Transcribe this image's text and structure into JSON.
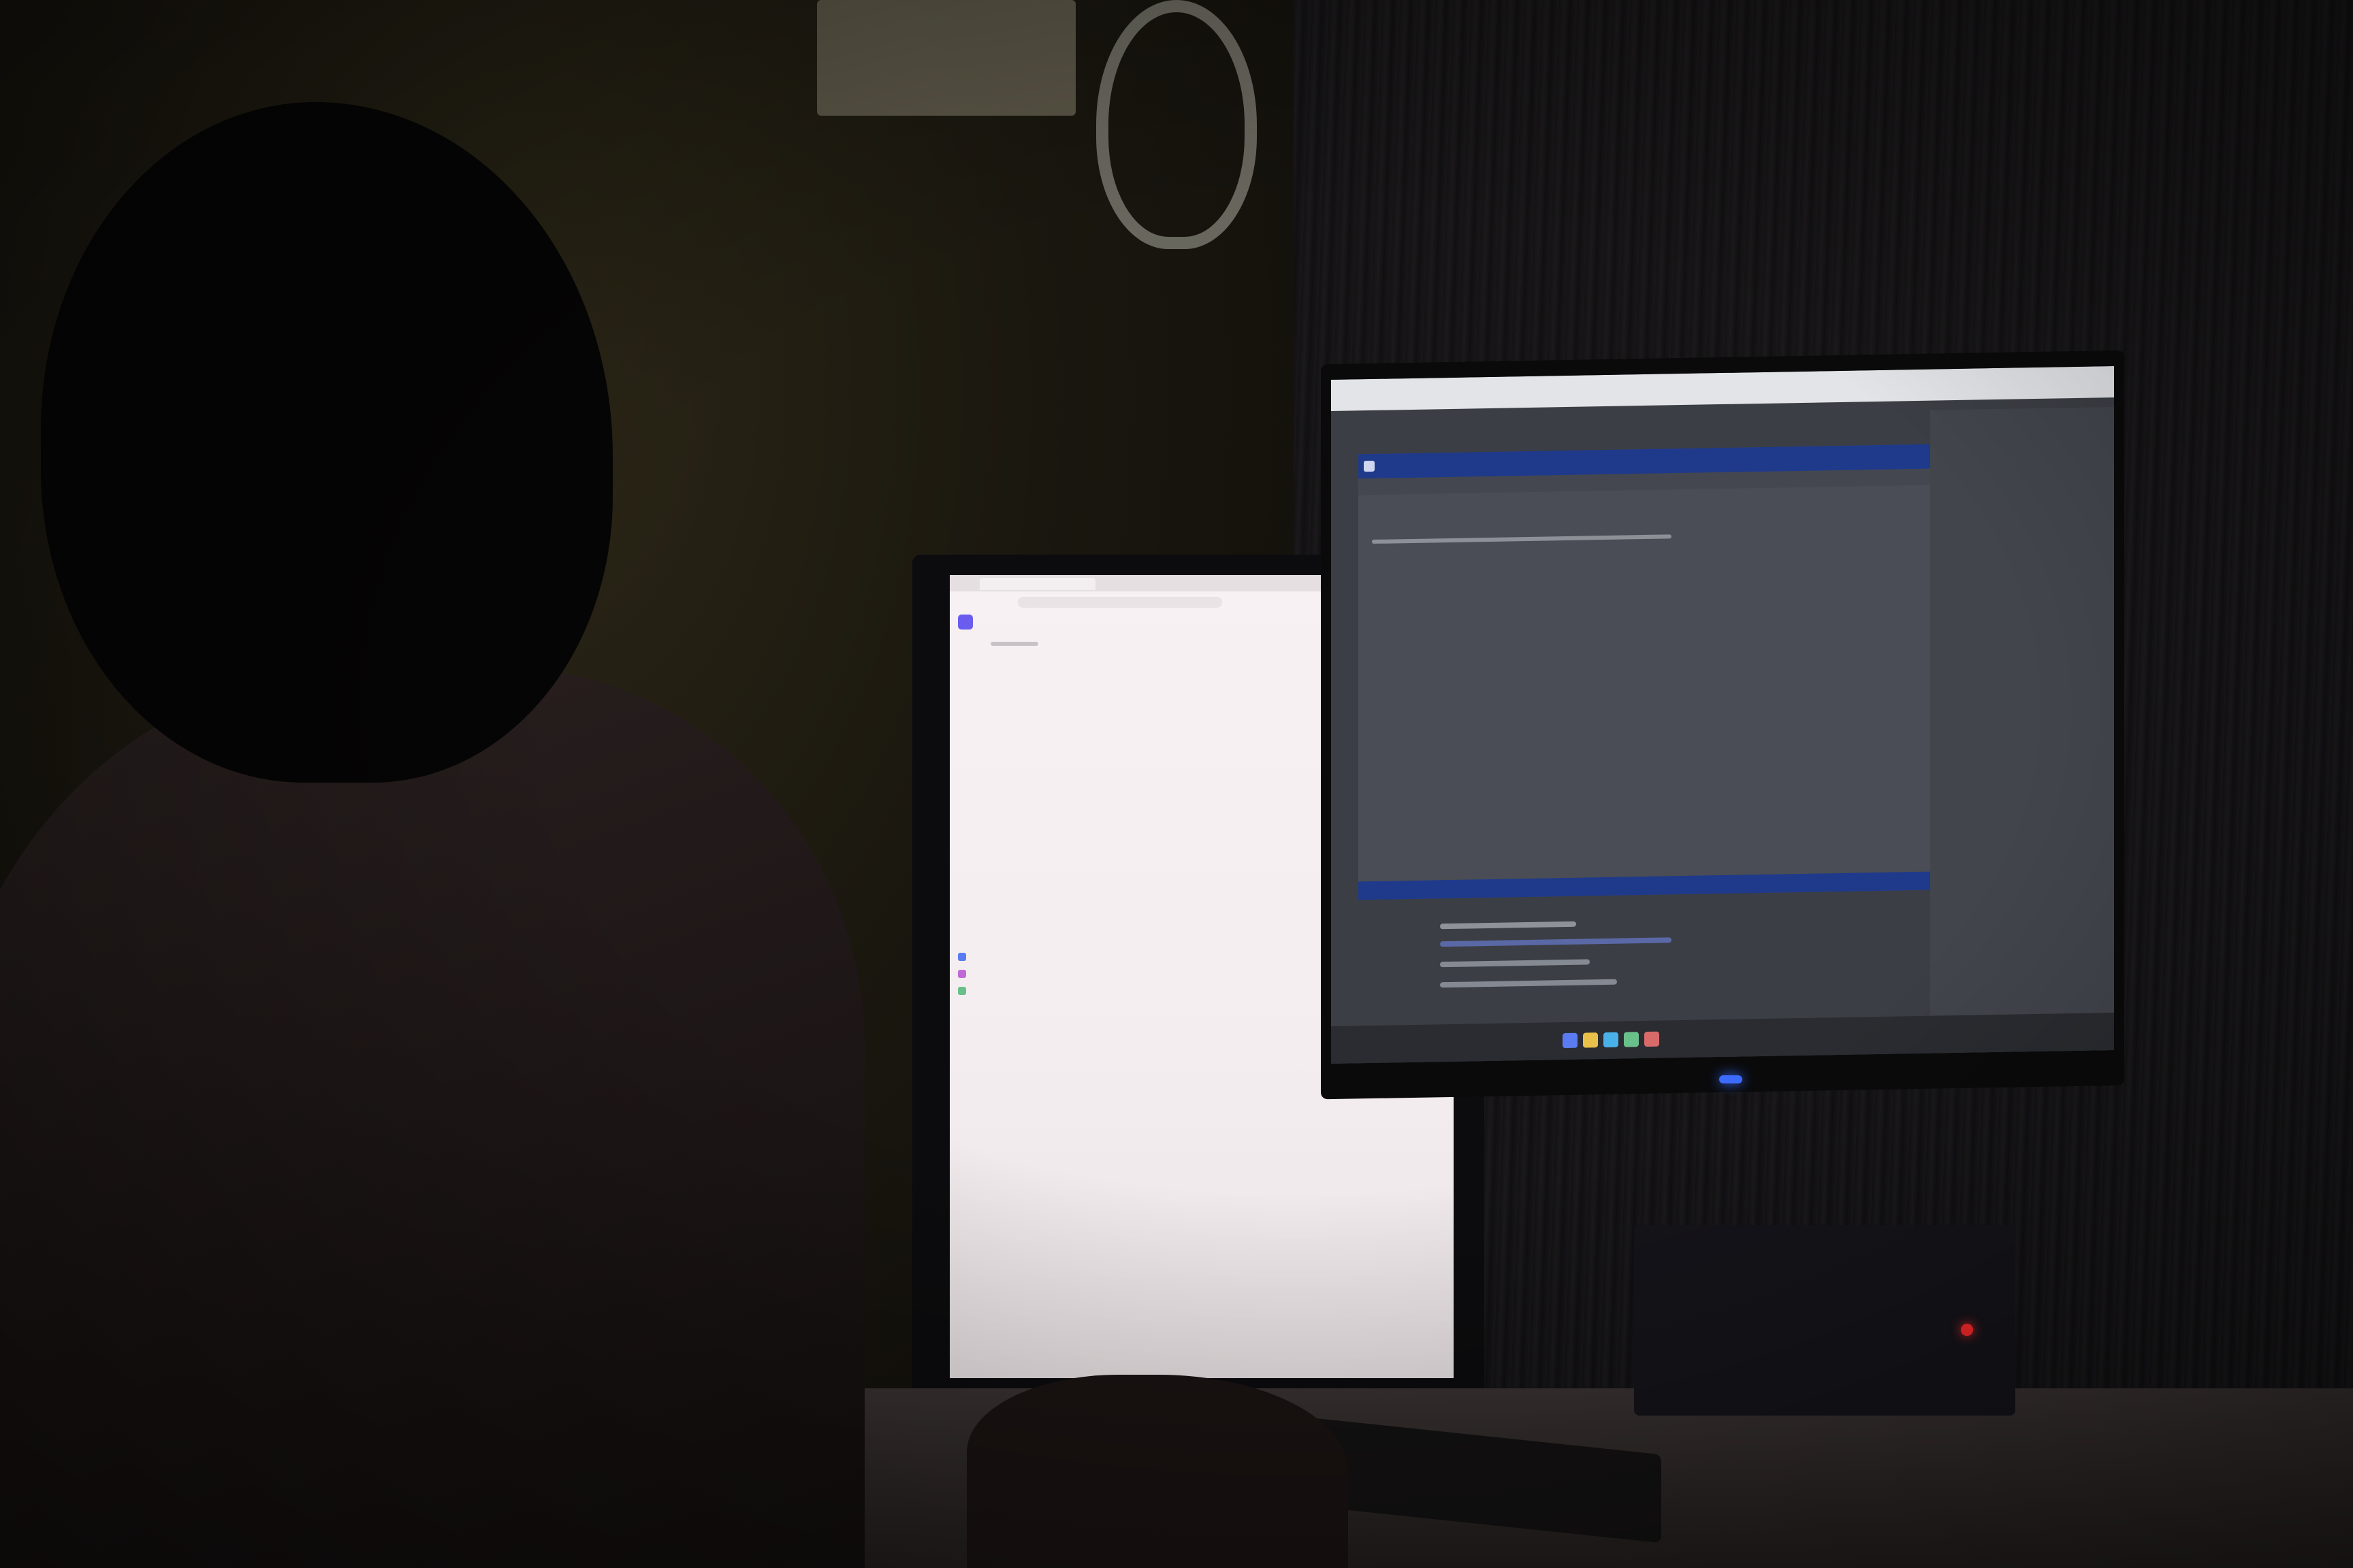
{
  "scene": {
    "colors": {
      "wall": "#1a170f",
      "curtain": "#141314",
      "screen_left": "#f5eff1",
      "screen_right": "#3b3e44",
      "editor_titlebar": "#1f3a8a",
      "power_led": "#3b6cff",
      "device_led": "#ff2a2a"
    },
    "icons": {
      "left_app_logo": "app-logo-icon",
      "right_editor_app": "app-icon"
    }
  }
}
